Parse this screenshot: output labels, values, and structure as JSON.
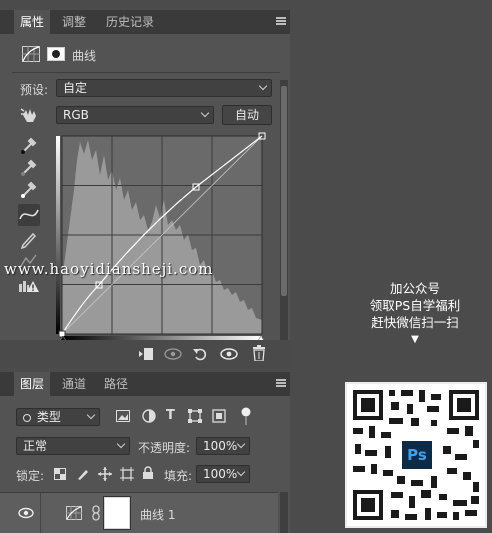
{
  "properties_panel": {
    "tabs": [
      {
        "label": "属性"
      },
      {
        "label": "调整"
      },
      {
        "label": "历史记录"
      }
    ],
    "adjustment_name": "曲线",
    "preset_label": "预设:",
    "preset_value": "自定",
    "channel_value": "RGB",
    "auto_button": "自动"
  },
  "watermark": "www.haoyidiansheji.com",
  "layers_panel": {
    "tabs": [
      {
        "label": "图层"
      },
      {
        "label": "通道"
      },
      {
        "label": "路径"
      }
    ],
    "filter_value": "类型",
    "blend_mode": "正常",
    "opacity_label": "不透明度:",
    "opacity_value": "100%",
    "lock_label": "锁定:",
    "fill_label": "填充:",
    "fill_value": "100%",
    "layer_name": "曲线 1"
  },
  "promo": {
    "line1": "加公众号",
    "line2": "领取PS自学福利",
    "line3": "赶快微信扫一扫",
    "arrow": "▼",
    "qr_logo": "Ps"
  },
  "colors": {
    "panel_bg": "#535353",
    "page_bg": "#4b4b4b",
    "tabbar_bg": "#3a3a3a",
    "ps_blue": "#41a0ee"
  }
}
